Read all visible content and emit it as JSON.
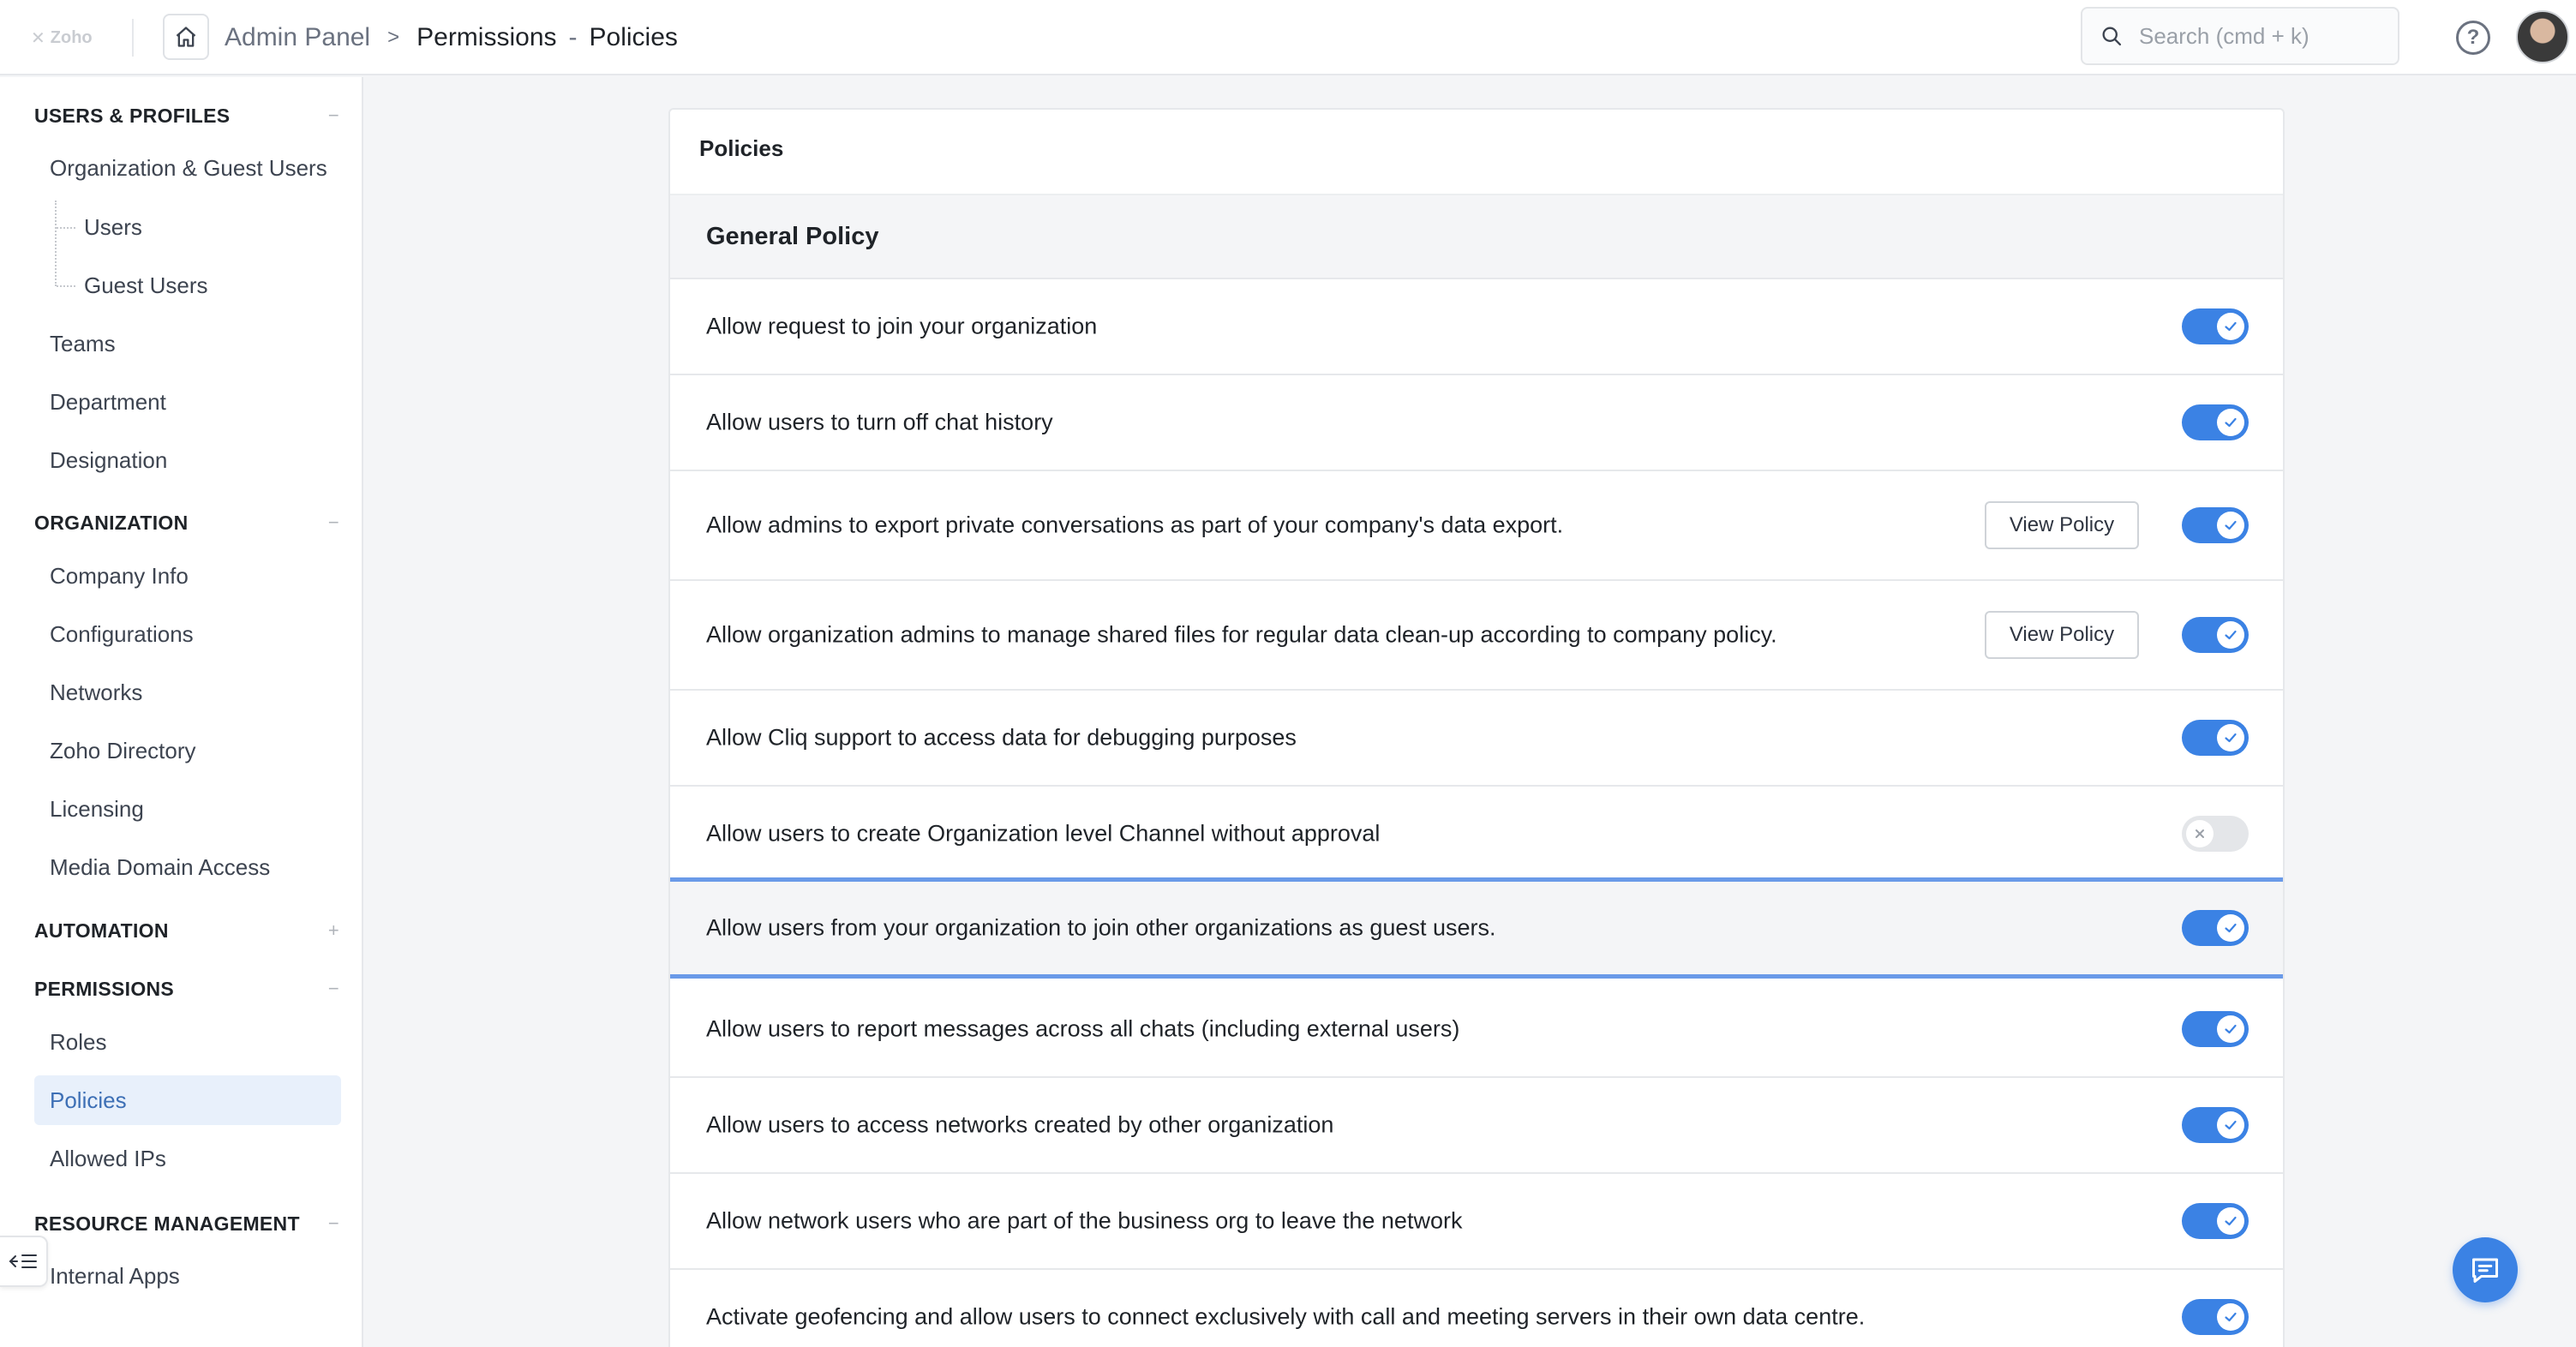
{
  "app": {
    "logo_text": "Zoho"
  },
  "header": {
    "breadcrumb_root": "Admin Panel",
    "breadcrumb_separator": ">",
    "breadcrumb_section": "Permissions",
    "breadcrumb_dash": "-",
    "breadcrumb_page": "Policies",
    "search_placeholder": "Search (cmd + k)"
  },
  "sidebar": {
    "sections": [
      {
        "title": "USERS & PROFILES",
        "toggle": "−",
        "items": [
          {
            "label": "Organization & Guest Users"
          },
          {
            "label": "Users",
            "sub": true
          },
          {
            "label": "Guest Users",
            "sub": true
          },
          {
            "label": "Teams"
          },
          {
            "label": "Department"
          },
          {
            "label": "Designation"
          }
        ]
      },
      {
        "title": "ORGANIZATION",
        "toggle": "−",
        "items": [
          {
            "label": "Company Info"
          },
          {
            "label": "Configurations"
          },
          {
            "label": "Networks"
          },
          {
            "label": "Zoho Directory"
          },
          {
            "label": "Licensing"
          },
          {
            "label": "Media Domain Access"
          }
        ]
      },
      {
        "title": "AUTOMATION",
        "toggle": "+",
        "items": []
      },
      {
        "title": "PERMISSIONS",
        "toggle": "−",
        "items": [
          {
            "label": "Roles"
          },
          {
            "label": "Policies",
            "active": true
          },
          {
            "label": "Allowed IPs"
          }
        ]
      },
      {
        "title": "RESOURCE MANAGEMENT",
        "toggle": "−",
        "items": [
          {
            "label": "Internal Apps"
          }
        ]
      }
    ]
  },
  "main": {
    "panel_title": "Policies",
    "group_title": "General Policy",
    "view_policy_label": "View Policy",
    "policies": [
      {
        "label": "Allow request to join your organization",
        "enabled": true,
        "view_policy": false
      },
      {
        "label": "Allow users to turn off chat history",
        "enabled": true,
        "view_policy": false
      },
      {
        "label": "Allow admins to export private conversations as part of your company's data export.",
        "enabled": true,
        "view_policy": true
      },
      {
        "label": "Allow organization admins to manage shared files for regular data clean-up according to company policy.",
        "enabled": true,
        "view_policy": true
      },
      {
        "label": "Allow Cliq support to access data for debugging purposes",
        "enabled": true,
        "view_policy": false
      },
      {
        "label": "Allow users to create Organization level Channel without approval",
        "enabled": false,
        "view_policy": false
      },
      {
        "label": "Allow users from your organization to join other organizations as guest users.",
        "enabled": true,
        "view_policy": false,
        "highlighted": true
      },
      {
        "label": "Allow users to report messages across all chats (including external users)",
        "enabled": true,
        "view_policy": false
      },
      {
        "label": "Allow users to access networks created by other organization",
        "enabled": true,
        "view_policy": false
      },
      {
        "label": "Allow network users who are part of the business org to leave the network",
        "enabled": true,
        "view_policy": false
      },
      {
        "label": "Activate geofencing and allow users to connect exclusively with call and meeting servers in their own data centre.",
        "enabled": true,
        "view_policy": false
      }
    ]
  },
  "colors": {
    "accent": "#3b82e4",
    "highlight_border": "#6a9ae8",
    "active_nav_bg": "#e8f0fb",
    "toggle_off": "#e4e6e9"
  },
  "icons": {
    "home": "home-icon",
    "search": "search-icon",
    "help": "help-icon",
    "toggle_on": "check-icon",
    "toggle_off": "x-icon",
    "sidebar_collapse": "collapse-sidebar-icon",
    "chat": "chat-icon"
  }
}
